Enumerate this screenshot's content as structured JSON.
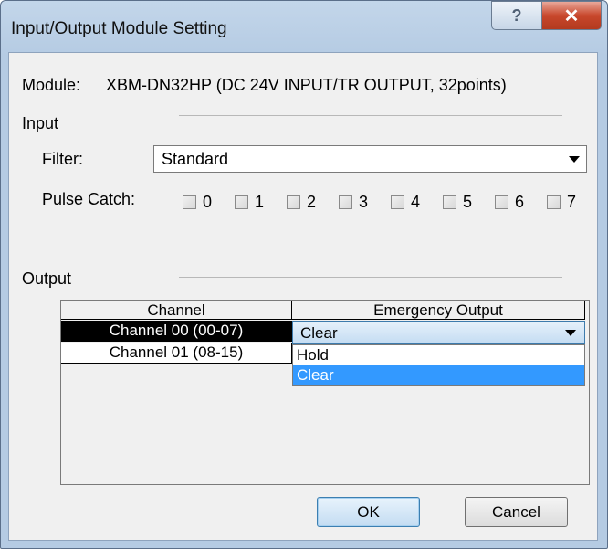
{
  "window": {
    "title": "Input/Output Module Setting",
    "help_glyph": "?",
    "close_glyph": "✕"
  },
  "module": {
    "label": "Module:",
    "value": "XBM-DN32HP (DC 24V INPUT/TR OUTPUT, 32points)"
  },
  "input": {
    "section_label": "Input",
    "filter_label": "Filter:",
    "filter_value": "Standard",
    "pulse_catch_label": "Pulse Catch:",
    "pulse_catch": [
      {
        "label": "0",
        "checked": false
      },
      {
        "label": "1",
        "checked": false
      },
      {
        "label": "2",
        "checked": false
      },
      {
        "label": "3",
        "checked": false
      },
      {
        "label": "4",
        "checked": false
      },
      {
        "label": "5",
        "checked": false
      },
      {
        "label": "6",
        "checked": false
      },
      {
        "label": "7",
        "checked": false
      }
    ]
  },
  "output": {
    "section_label": "Output",
    "columns": [
      "Channel",
      "Emergency Output"
    ],
    "rows": [
      {
        "channel": "Channel 00 (00-07)",
        "emergency": "Clear"
      },
      {
        "channel": "Channel 01 (08-15)",
        "emergency": ""
      }
    ],
    "dropdown_options": [
      "Hold",
      "Clear"
    ],
    "highlighted_option": "Clear"
  },
  "buttons": {
    "ok": "OK",
    "cancel": "Cancel"
  },
  "colors": {
    "selection": "#3399ff",
    "close_button": "#c8472c",
    "title_bar": "#b9cfe6"
  }
}
